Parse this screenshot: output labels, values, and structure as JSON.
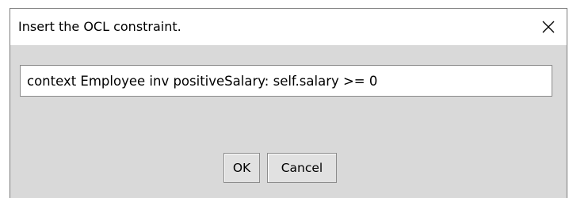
{
  "dialog": {
    "title": "Insert the OCL constraint.",
    "close_icon": "close-icon"
  },
  "constraint_input": {
    "value": "context Employee inv positiveSalary: self.salary >= 0"
  },
  "buttons": {
    "ok_label": "OK",
    "cancel_label": "Cancel"
  },
  "colors": {
    "client_background": "#d9d9d9",
    "titlebar_background": "#ffffff",
    "input_border": "#8a8a8a",
    "button_background": "#e1e1e1"
  }
}
